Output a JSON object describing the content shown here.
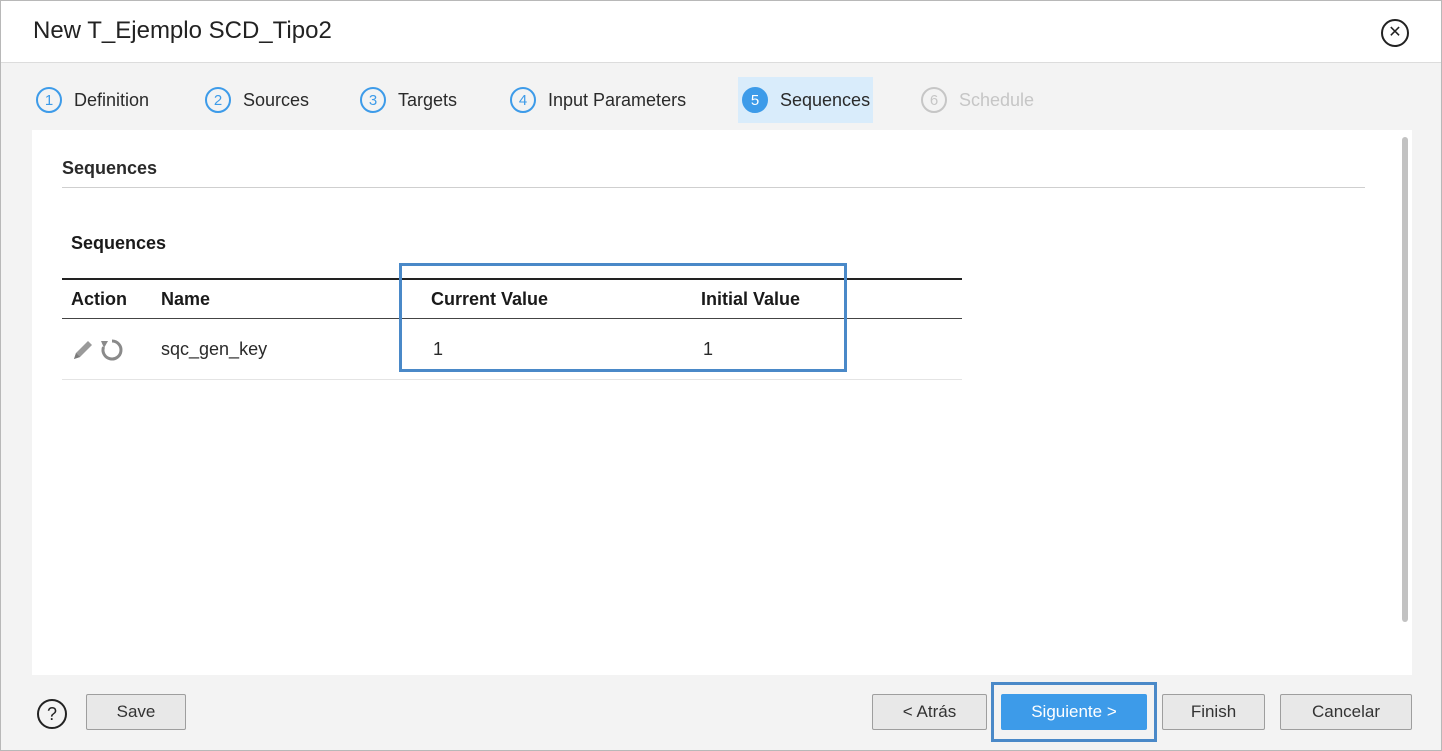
{
  "dialog": {
    "title": "New T_Ejemplo SCD_Tipo2",
    "close_glyph": "✕"
  },
  "steps": [
    {
      "number": "1",
      "label": "Definition",
      "state": "done"
    },
    {
      "number": "2",
      "label": "Sources",
      "state": "done"
    },
    {
      "number": "3",
      "label": "Targets",
      "state": "done"
    },
    {
      "number": "4",
      "label": "Input Parameters",
      "state": "done"
    },
    {
      "number": "5",
      "label": "Sequences",
      "state": "active"
    },
    {
      "number": "6",
      "label": "Schedule",
      "state": "disabled"
    }
  ],
  "section": {
    "title": "Sequences"
  },
  "sequences_table": {
    "title": "Sequences",
    "columns": [
      "Action",
      "Name",
      "Current Value",
      "Initial Value"
    ],
    "rows": [
      {
        "actions": [
          "edit-icon",
          "reset-icon"
        ],
        "name": "sqc_gen_key",
        "current_value": "1",
        "initial_value": "1"
      }
    ]
  },
  "footer": {
    "help_glyph": "?",
    "save_label": "Save",
    "back_label": "< Atrás",
    "next_label": "Siguiente >",
    "finish_label": "Finish",
    "cancel_label": "Cancelar"
  },
  "colors": {
    "accent": "#3d9be9",
    "active_step_bg": "#d9ecfb",
    "highlight_box": "#4a89c8"
  }
}
